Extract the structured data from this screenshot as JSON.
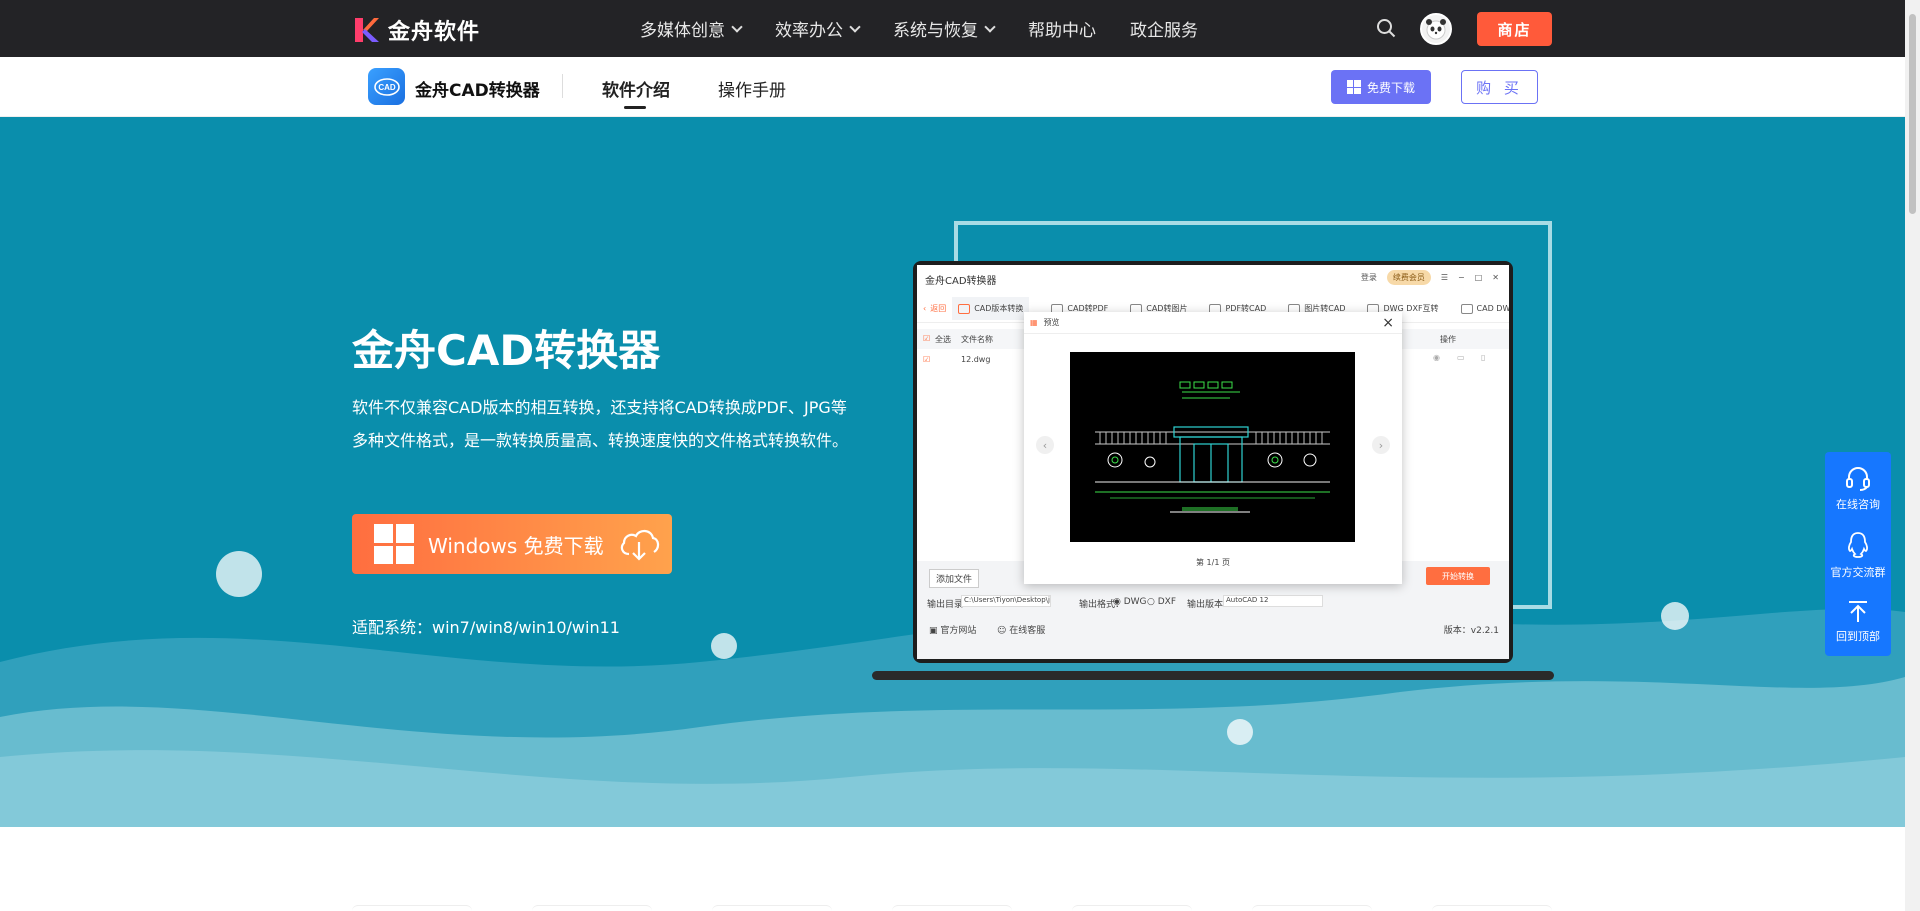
{
  "topnav": {
    "brand": "金舟软件",
    "items": [
      {
        "label": "多媒体创意",
        "has_dropdown": true
      },
      {
        "label": "效率办公",
        "has_dropdown": true
      },
      {
        "label": "系统与恢复",
        "has_dropdown": true
      },
      {
        "label": "帮助中心",
        "has_dropdown": false
      },
      {
        "label": "政企服务",
        "has_dropdown": false
      }
    ],
    "shop_label": "商店"
  },
  "subnav": {
    "product_name": "金舟CAD转换器",
    "tabs": [
      {
        "label": "软件介绍",
        "active": true
      },
      {
        "label": "操作手册",
        "active": false
      }
    ],
    "free_download_label": "免费下载",
    "buy_label": "购 买"
  },
  "hero": {
    "title": "金舟CAD转换器",
    "description": "软件不仅兼容CAD版本的相互转换，还支持将CAD转换成PDF、JPG等多种文件格式，是一款转换质量高、转换速度快的文件格式转换软件。",
    "download_label": "Windows 免费下载",
    "compat": "适配系统：win7/win8/win10/win11"
  },
  "app_mock": {
    "title": "金舟CAD转换器",
    "login": "登录",
    "vip": "续费会员",
    "tabs": [
      "返回",
      "CAD版本转换",
      "CAD转PDF",
      "CAD转图片",
      "PDF转CAD",
      "图片转CAD",
      "DWG DXF互转",
      "CAD DWF互转"
    ],
    "table_headers": {
      "select_all": "全选",
      "filename": "文件名称",
      "action": "操作"
    },
    "row_file": "12.dwg",
    "preview_title": "预览",
    "page_info": "第 1/1 页",
    "add_file": "添加文件",
    "start": "开始转换",
    "output_dir_label": "输出目录：",
    "output_dir": "C:\\Users\\Tiyon\\Desktop\\j",
    "output_format_label": "输出格式：",
    "formats": [
      "DWG",
      "DXF"
    ],
    "output_version_label": "输出版本：",
    "output_version": "AutoCAD 12",
    "official_site": "官方网站",
    "online_support": "在线客服",
    "version": "版本：v2.2.1"
  },
  "side_float": {
    "items": [
      "在线咨询",
      "官方交流群",
      "回到顶部"
    ]
  },
  "colors": {
    "topnav_bg": "#232326",
    "hero_bg": "#0a8eac",
    "shop": "#ff5a3a",
    "accent": "#6b72f5",
    "download_gradient_start": "#ff6e40",
    "download_gradient_end": "#ffa24c",
    "side_float": "#1677ff"
  }
}
